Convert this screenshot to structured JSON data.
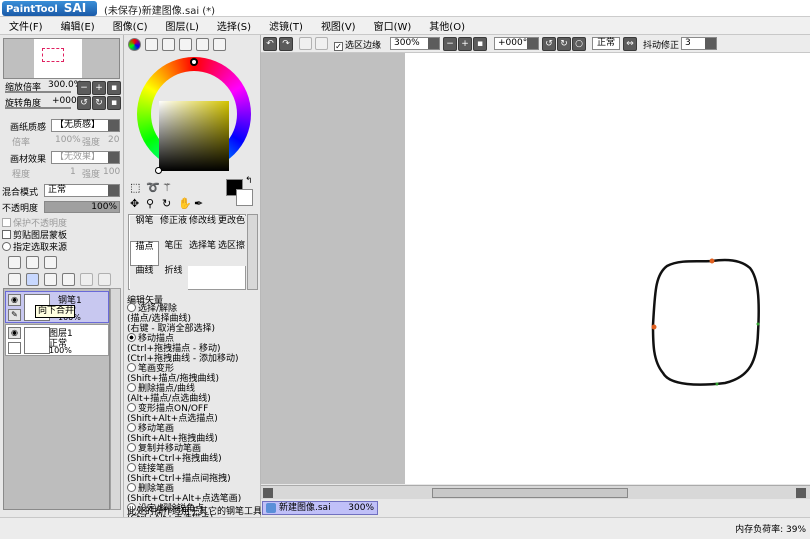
{
  "titlebar": {
    "logo_text": "PaintTool",
    "logo_brand": "SAI",
    "title": "(未保存)新建图像.sai (*)"
  },
  "menu": [
    "文件(F)",
    "编辑(E)",
    "图像(C)",
    "图层(L)",
    "选择(S)",
    "滤镜(T)",
    "视图(V)",
    "窗口(W)",
    "其他(O)"
  ],
  "navigator": {
    "zoom_label": "缩放倍率",
    "zoom_value": "300.0%",
    "rotate_label": "旋转角度",
    "rotate_value": "+000"
  },
  "paper": {
    "texture_label": "画纸质感",
    "texture_value": "【无质感】",
    "magnify_label": "倍率",
    "magnify_value": "100%",
    "strength_label": "强度",
    "strength_value": "20",
    "effect_label": "画材效果",
    "effect_value": "【无效果】",
    "degree_label": "程度",
    "degree_value": "1",
    "intensity_label": "强度",
    "intensity_value": "100"
  },
  "blend": {
    "mode_label": "混合模式",
    "mode_value": "正常",
    "opacity_label": "不透明度",
    "opacity_value": "100%"
  },
  "layer_opts": {
    "protect": "保护不透明度",
    "clip": "剪贴图层蒙板",
    "source": "指定选取来源"
  },
  "layers": [
    {
      "name": "钢笔1",
      "mode": "正常",
      "opacity": "100%",
      "active": true
    },
    {
      "name": "图层1",
      "mode": "正常",
      "opacity": "100%",
      "active": false
    }
  ],
  "tooltip": "向下合并",
  "tools": [
    [
      "钢笔",
      "修正液",
      "修改线",
      "更改色"
    ],
    [
      "描点",
      "笔压",
      "选择笔",
      "选区擦"
    ],
    [
      "曲线",
      "折线",
      "",
      ""
    ]
  ],
  "edit_header": "编辑矢量",
  "edit_options": [
    {
      "text": "选择/解除\n(描点/选择曲线)\n(右键 - 取消全部选择)",
      "on": false
    },
    {
      "text": "移动描点\n(Ctrl+拖拽描点 - 移动)\n(Ctrl+拖拽曲线 - 添加移动)",
      "on": true
    },
    {
      "text": "笔画变形\n(Shift+描点/拖拽曲线)",
      "on": false
    },
    {
      "text": "删除描点/曲线\n(Alt+描点/点选曲线)",
      "on": false
    },
    {
      "text": "变形描点ON/OFF\n(Shift+Alt+点选描点)",
      "on": false
    },
    {
      "text": "移动笔画\n(Shift+Alt+拖拽曲线)",
      "on": false
    },
    {
      "text": "复制并移动笔画\n(Shift+Ctrl+拖拽曲线)",
      "on": false
    },
    {
      "text": "链接笔画\n(Shift+Ctrl+描点间拖拽)",
      "on": false
    },
    {
      "text": "删除笔画\n(Shift+Ctrl+Alt+点选笔画)",
      "on": false
    },
    {
      "text": "设定/解除锐角点\n(Ctrl+Alt+点选描点)",
      "on": false
    }
  ],
  "edit_footer": "此处的操作适用于其它的钢笔工具",
  "toolbar2": {
    "selection_edge": "选区边缘",
    "zoom": "300%",
    "rotate": "+000°",
    "mode": "正常",
    "stab_label": "抖动修正",
    "stab_value": "3"
  },
  "doc_tab": {
    "name": "新建图像.sai",
    "zoom": "300%"
  },
  "status": {
    "memory": "内存负荷率: 39%"
  },
  "colors": {
    "accent": "#c0c0f8",
    "menu_bg": "#f0f0f0",
    "panel_bg": "#e8e8e8"
  }
}
